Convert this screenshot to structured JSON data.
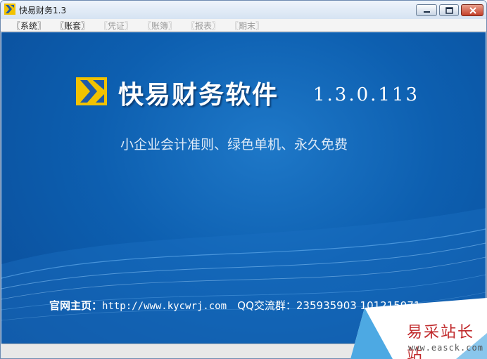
{
  "window": {
    "title": "快易财务1.3"
  },
  "menu": [
    {
      "label": "〖系统〗",
      "enabled": true
    },
    {
      "label": "〖账套〗",
      "enabled": true
    },
    {
      "label": "〖凭证〗",
      "enabled": false
    },
    {
      "label": "〖账簿〗",
      "enabled": false
    },
    {
      "label": "〖报表〗",
      "enabled": false
    },
    {
      "label": "〖期末〗",
      "enabled": false
    }
  ],
  "splash": {
    "product_name": "快易财务软件",
    "version": "1.3.0.113",
    "tagline": "小企业会计准则、绿色单机、永久免费",
    "homepage_label": "官网主页：",
    "homepage_url": "http://www.kycwrj.com",
    "qq_label": "QQ交流群：",
    "qq_numbers": "235935903  101215971"
  },
  "watermark": {
    "text": "易采站长站",
    "url": "www.easck.com"
  },
  "colors": {
    "splash_blue": "#0d5fb0",
    "logo_yellow": "#f2c200",
    "watermark_red": "#c0282a"
  }
}
